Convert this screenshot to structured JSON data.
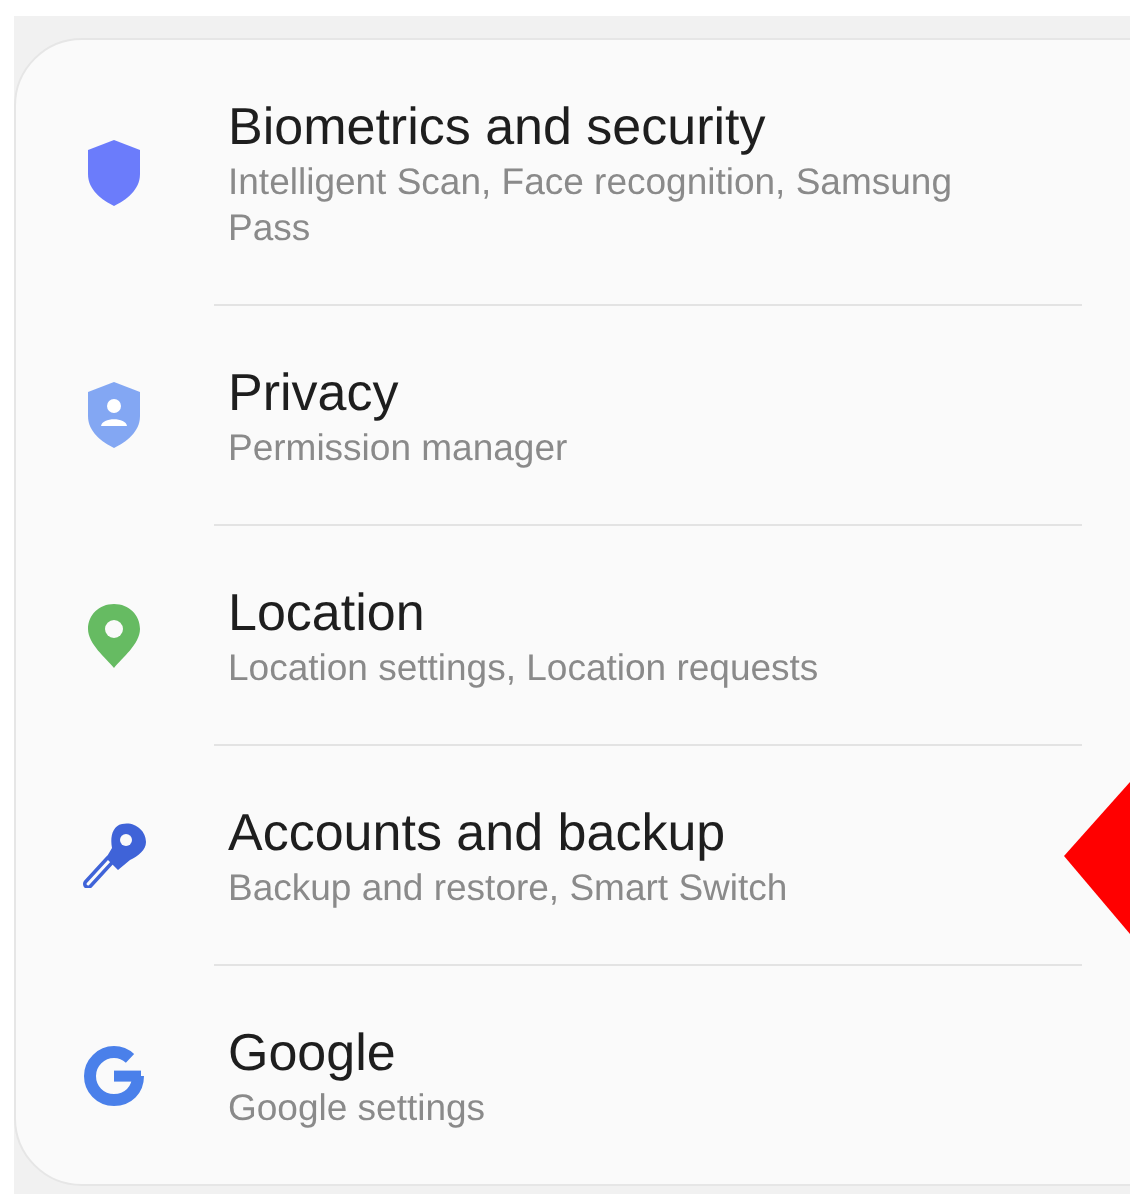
{
  "items": [
    {
      "kind": "shield",
      "title": "Biometrics and security",
      "subtitle": "Intelligent Scan, Face recognition, Samsung Pass"
    },
    {
      "kind": "privacy",
      "title": "Privacy",
      "subtitle": "Permission manager"
    },
    {
      "kind": "pin",
      "title": "Location",
      "subtitle": "Location settings, Location requests"
    },
    {
      "kind": "key",
      "title": "Accounts and backup",
      "subtitle": "Backup and restore, Smart Switch"
    },
    {
      "kind": "google",
      "title": "Google",
      "subtitle": "Google settings"
    }
  ]
}
